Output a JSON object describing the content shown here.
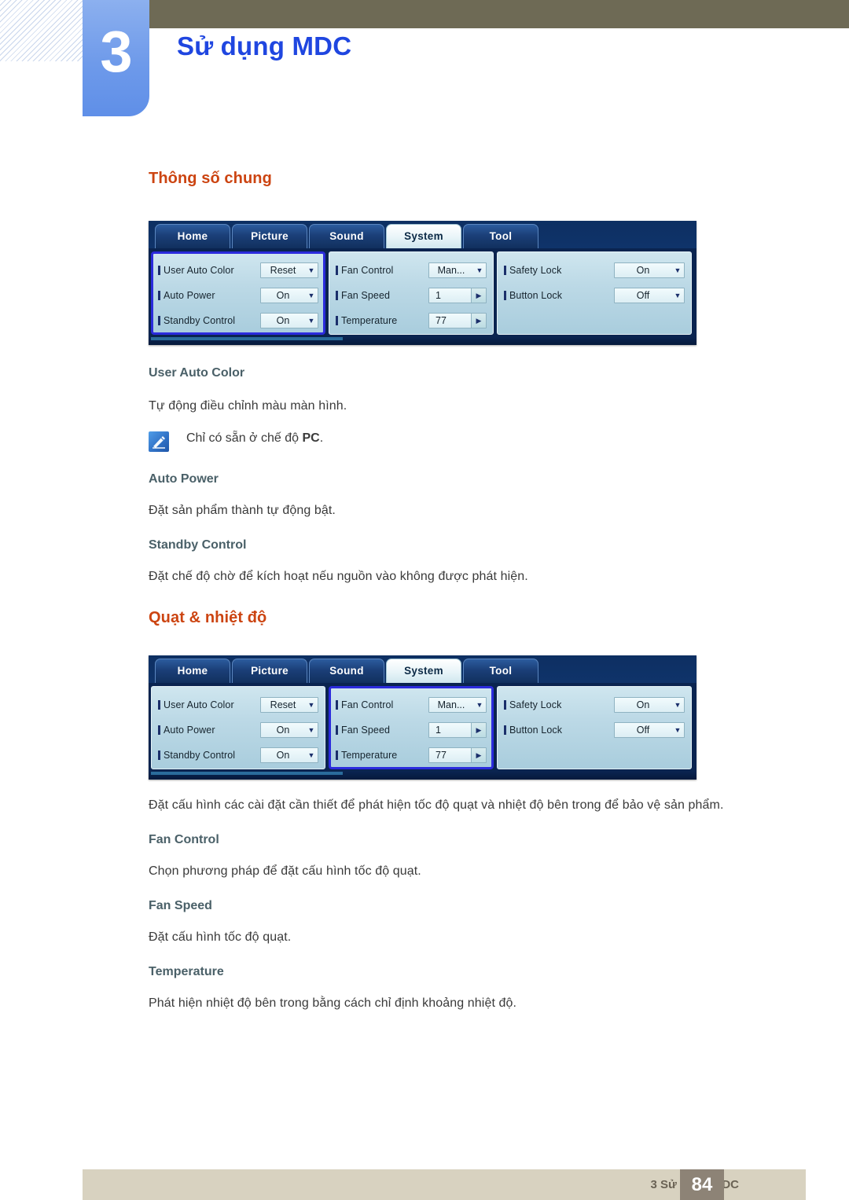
{
  "header": {
    "chapter_number": "3",
    "chapter_title": "Sử dụng MDC"
  },
  "sections": {
    "general": {
      "heading": "Thông số chung",
      "items": [
        {
          "title": "User Auto Color",
          "body": "Tự động điều chỉnh màu màn hình."
        },
        {
          "title": "Auto Power",
          "body": "Đặt sản phẩm thành tự động bật."
        },
        {
          "title": "Standby Control",
          "body": "Đặt chế độ chờ để kích hoạt nếu nguồn vào không được phát hiện."
        }
      ],
      "note": {
        "icon": "note-pencil-icon",
        "text_before": "Chỉ có sẵn ở chế độ ",
        "text_bold": "PC",
        "text_after": "."
      }
    },
    "fan": {
      "heading": "Quạt & nhiệt độ",
      "intro": "Đặt cấu hình các cài đặt cần thiết để phát hiện tốc độ quạt và nhiệt độ bên trong để bảo vệ sản phẩm.",
      "items": [
        {
          "title": "Fan Control",
          "body": "Chọn phương pháp để đặt cấu hình tốc độ quạt."
        },
        {
          "title": "Fan Speed",
          "body": "Đặt cấu hình tốc độ quạt."
        },
        {
          "title": "Temperature",
          "body": "Phát hiện nhiệt độ bên trong bằng cách chỉ định khoảng nhiệt độ."
        }
      ]
    }
  },
  "mdc": {
    "tabs": [
      {
        "label": "Home",
        "active": false
      },
      {
        "label": "Picture",
        "active": false
      },
      {
        "label": "Sound",
        "active": false
      },
      {
        "label": "System",
        "active": true
      },
      {
        "label": "Tool",
        "active": false
      }
    ],
    "columns": {
      "general": [
        {
          "label": "User Auto Color",
          "value": "Reset",
          "control": "dropdown"
        },
        {
          "label": "Auto Power",
          "value": "On",
          "control": "dropdown"
        },
        {
          "label": "Standby Control",
          "value": "On",
          "control": "dropdown"
        }
      ],
      "fan": [
        {
          "label": "Fan Control",
          "value": "Man...",
          "control": "dropdown"
        },
        {
          "label": "Fan Speed",
          "value": "1",
          "control": "spinner"
        },
        {
          "label": "Temperature",
          "value": "77",
          "control": "spinner"
        }
      ],
      "lock": [
        {
          "label": "Safety Lock",
          "value": "On",
          "control": "dropdown"
        },
        {
          "label": "Button Lock",
          "value": "Off",
          "control": "dropdown"
        }
      ]
    },
    "highlight_first": "general",
    "highlight_second": "fan"
  },
  "footer": {
    "text": "3 Sử dụng MDC",
    "page": "84"
  },
  "colors": {
    "chapter_title": "#1f46e0",
    "section_heading": "#cc4411",
    "sub_heading": "#4a6068",
    "olive_bar": "#6e6a55",
    "chapter_tab": "#6e9aea",
    "footer_bar": "#d8d2c0",
    "footer_page": "#8d8376",
    "selection_border": "#2b2bdd"
  }
}
